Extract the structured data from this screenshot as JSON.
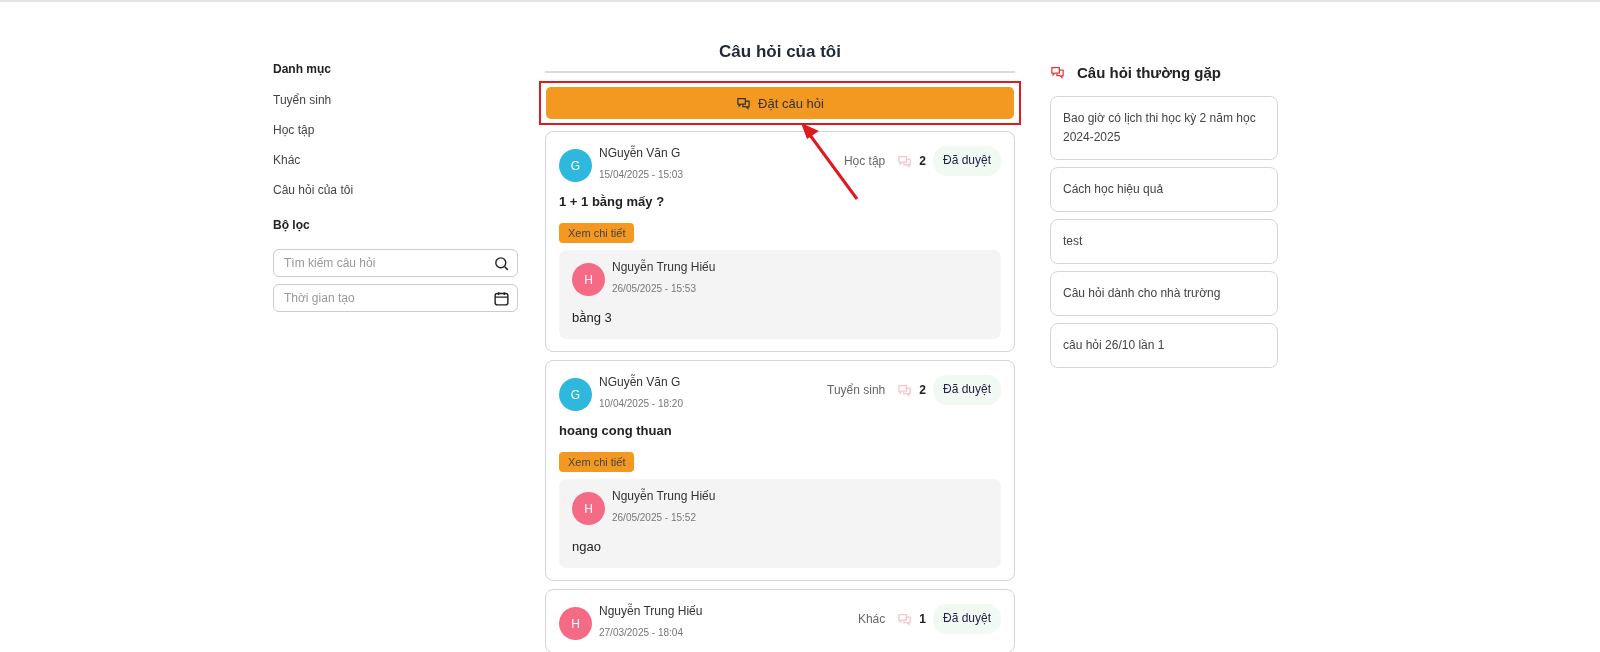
{
  "sidebar": {
    "categories_title": "Danh mục",
    "categories": [
      {
        "label": "Tuyển sinh"
      },
      {
        "label": "Học tập"
      },
      {
        "label": "Khác"
      },
      {
        "label": "Câu hỏi của tôi"
      }
    ],
    "filter_title": "Bộ lọc",
    "search": {
      "placeholder": "Tìm kiếm câu hỏi"
    },
    "date": {
      "placeholder": "Thời gian tạo"
    }
  },
  "main": {
    "title": "Câu hỏi của tôi",
    "ask_button": "Đặt câu hỏi",
    "highlighted": true,
    "questions": [
      {
        "avatar": "G",
        "color": "#2fb8de",
        "author": "NGuyễn Văn G",
        "time": "15/04/2025 - 15:03",
        "category": "Học tập",
        "comments": "2",
        "status": "Đã duyệt",
        "title": "1 + 1 bằng mấy ?",
        "detail_button": "Xem chi tiết",
        "answer": {
          "avatar": "H",
          "color": "#f56b86",
          "author": "Nguyễn Trung Hiếu",
          "time": "26/05/2025 - 15:53",
          "text": "bằng 3"
        }
      },
      {
        "avatar": "G",
        "color": "#2fb8de",
        "author": "NGuyễn Văn G",
        "time": "10/04/2025 - 18:20",
        "category": "Tuyển sinh",
        "comments": "2",
        "status": "Đã duyệt",
        "title": "hoang cong thuan",
        "detail_button": "Xem chi tiết",
        "answer": {
          "avatar": "H",
          "color": "#f56b86",
          "author": "Nguyễn Trung Hiếu",
          "time": "26/05/2025 - 15:52",
          "text": "ngao"
        }
      },
      {
        "avatar": "H",
        "color": "#f56b86",
        "author": "Nguyễn Trung Hiếu",
        "time": "27/03/2025 - 18:04",
        "category": "Khác",
        "comments": "1",
        "status": "Đã duyệt"
      }
    ]
  },
  "faq": {
    "title": "Câu hỏi thường gặp",
    "items": [
      "Bao giờ có lịch thi học kỳ 2 năm học 2024-2025",
      "Cách học hiệu quả",
      "test",
      "Câu hỏi dành cho nhà trường",
      "câu hỏi 26/10 lần 1"
    ]
  }
}
